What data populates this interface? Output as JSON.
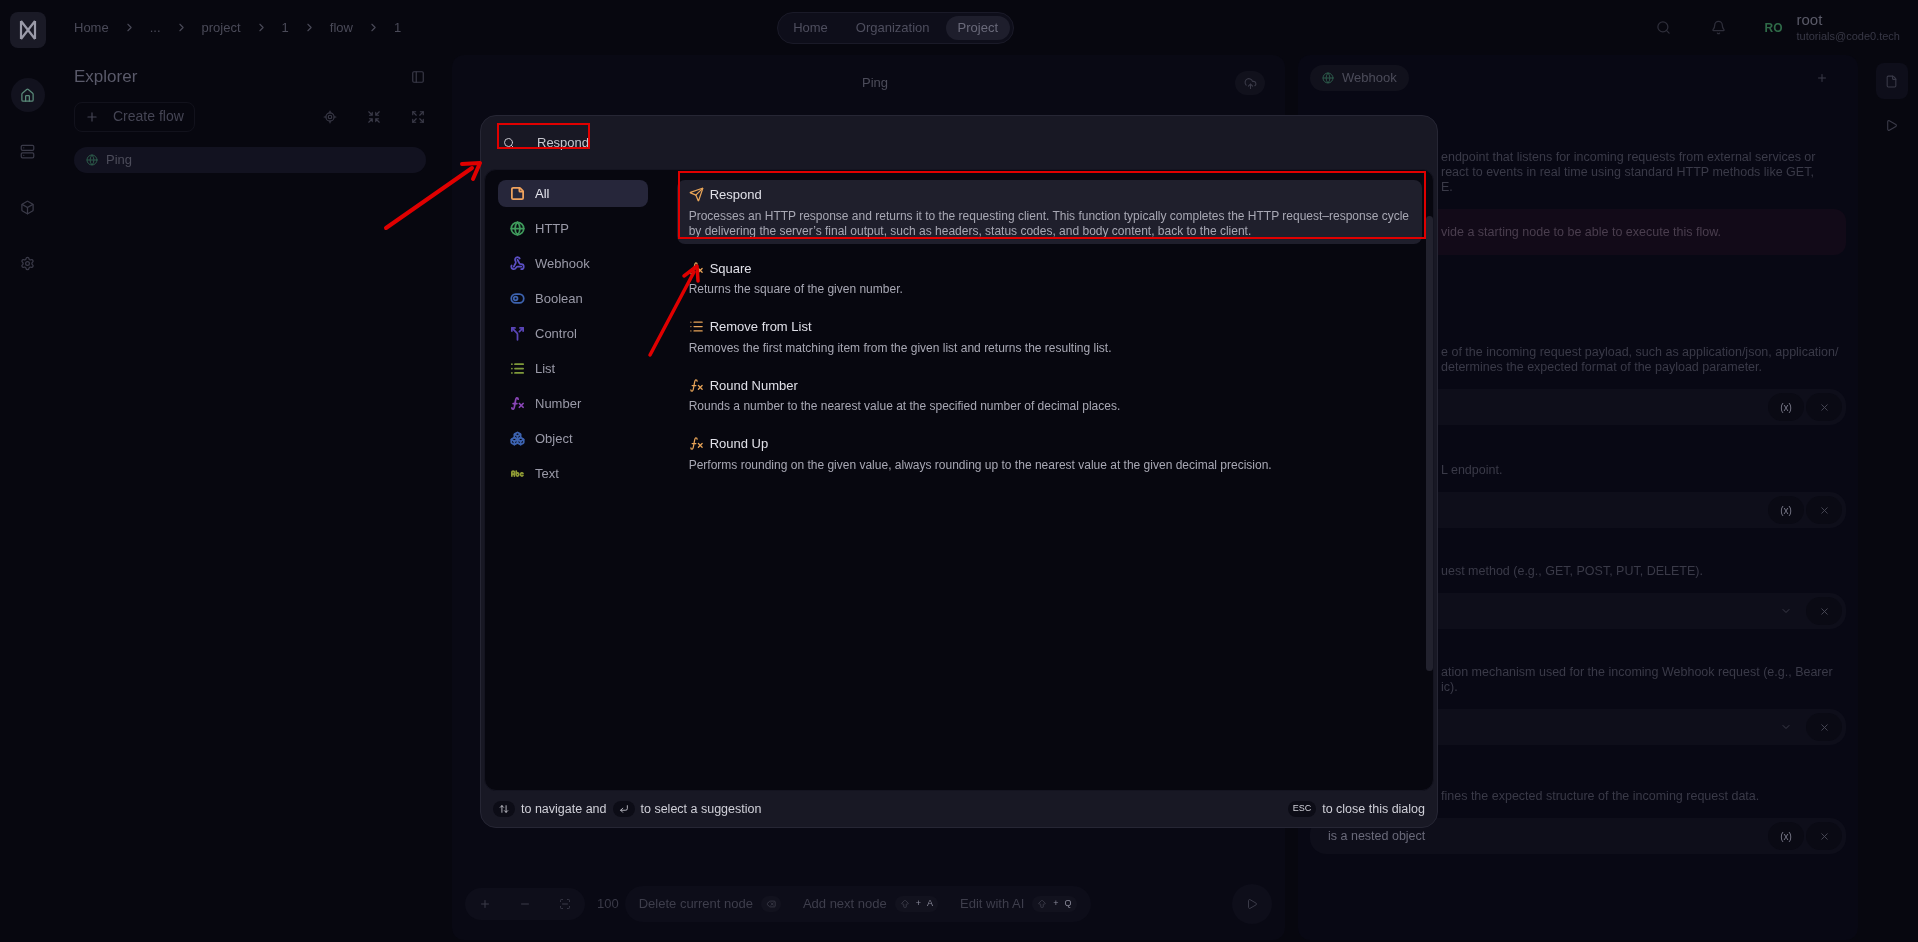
{
  "rail": [
    {
      "kind": "home",
      "selected": true
    },
    {
      "kind": "database",
      "selected": false
    },
    {
      "kind": "package",
      "selected": false
    },
    {
      "kind": "settings",
      "selected": false
    }
  ],
  "breadcrumb": [
    "Home",
    "...",
    "project",
    "1",
    "flow",
    "1"
  ],
  "nav_tabs": [
    {
      "label": "Home",
      "selected": false
    },
    {
      "label": "Organization",
      "selected": false
    },
    {
      "label": "Project",
      "selected": true
    }
  ],
  "user": {
    "initials": "RO",
    "name": "root",
    "email": "tutorials@code0.tech"
  },
  "explorer": {
    "title": "Explorer",
    "create_button": "Create flow",
    "flows": [
      {
        "label": "Ping",
        "selected": true
      }
    ]
  },
  "canvas": {
    "title": "Ping",
    "zoom": "100",
    "actions": [
      {
        "label": "Delete current node",
        "kind": "backspace"
      },
      {
        "label": "Add next node",
        "kind": "shift",
        "keys": [
          "+",
          "A"
        ]
      },
      {
        "label": "Edit with AI",
        "kind": "shift",
        "keys": [
          "+",
          "Q"
        ]
      }
    ]
  },
  "node_panel": {
    "tab": "Webhook",
    "description_lines": [
      "endpoint that listens for incoming requests from external services or",
      "react to events in real time using standard HTTP methods like GET,",
      "E."
    ],
    "warning": "vide a starting node to be able to execute this flow.",
    "parameters": [
      {
        "kind": "variable",
        "description_lines": [
          "e of the incoming request payload, such as application/json, application/",
          "determines the expected format of the payload parameter."
        ],
        "variable_button": "(x)"
      },
      {
        "kind": "variable",
        "description_lines": [
          "L endpoint."
        ],
        "variable_button": "(x)"
      },
      {
        "kind": "select",
        "description_lines": [
          "uest method (e.g., GET, POST, PUT, DELETE)."
        ]
      },
      {
        "kind": "select",
        "description_lines": [
          "ation mechanism used for the incoming Webhook request (e.g., Bearer",
          "ic)."
        ]
      },
      {
        "kind": "variable",
        "description_lines": [
          "fines the expected structure of the incoming request data."
        ],
        "variable_button": "(x)",
        "placeholder": "is a nested object"
      }
    ]
  },
  "dialog": {
    "search": {
      "value": "Respond"
    },
    "categories": [
      {
        "label": "All",
        "kind": "all",
        "color": "#f0a35e",
        "selected": true
      },
      {
        "label": "HTTP",
        "kind": "http",
        "color": "#3f9a5c",
        "selected": false
      },
      {
        "label": "Webhook",
        "kind": "webhook",
        "color": "#5b4fc4",
        "selected": false
      },
      {
        "label": "Boolean",
        "kind": "boolean",
        "color": "#3d63b0",
        "selected": false
      },
      {
        "label": "Control",
        "kind": "control",
        "color": "#5a45b8",
        "selected": false
      },
      {
        "label": "List",
        "kind": "list",
        "color": "#7f9a3a",
        "selected": false
      },
      {
        "label": "Number",
        "kind": "number",
        "color": "#8a46b8",
        "selected": false
      },
      {
        "label": "Object",
        "kind": "object",
        "color": "#3d63b0",
        "selected": false
      },
      {
        "label": "Text",
        "kind": "text",
        "color": "#8f9a34",
        "selected": false
      }
    ],
    "results": [
      {
        "kind": "respond",
        "title": "Respond",
        "description": "Processes an HTTP response and returns it to the requesting client. This function typically completes the HTTP request–response cycle by delivering the server’s final output, such as headers, status codes, and body content, back to the client.",
        "selected": true
      },
      {
        "kind": "function",
        "title": "Square",
        "description": "Returns the square of the given number.",
        "selected": false
      },
      {
        "kind": "list",
        "title": "Remove from List",
        "description": "Removes the first matching item from the given list and returns the resulting list.",
        "selected": false
      },
      {
        "kind": "function",
        "title": "Round Number",
        "description": "Rounds a number to the nearest value at the specified number of decimal places.",
        "selected": false
      },
      {
        "kind": "function",
        "title": "Round Up",
        "description": "Performs rounding on the given value, always rounding up to the nearest value at the given decimal precision.",
        "selected": false
      }
    ],
    "footer": {
      "navigate_hint": "to navigate and",
      "select_hint": "to select a suggestion",
      "close_key": "ESC",
      "close_hint": "to close this dialog"
    }
  }
}
